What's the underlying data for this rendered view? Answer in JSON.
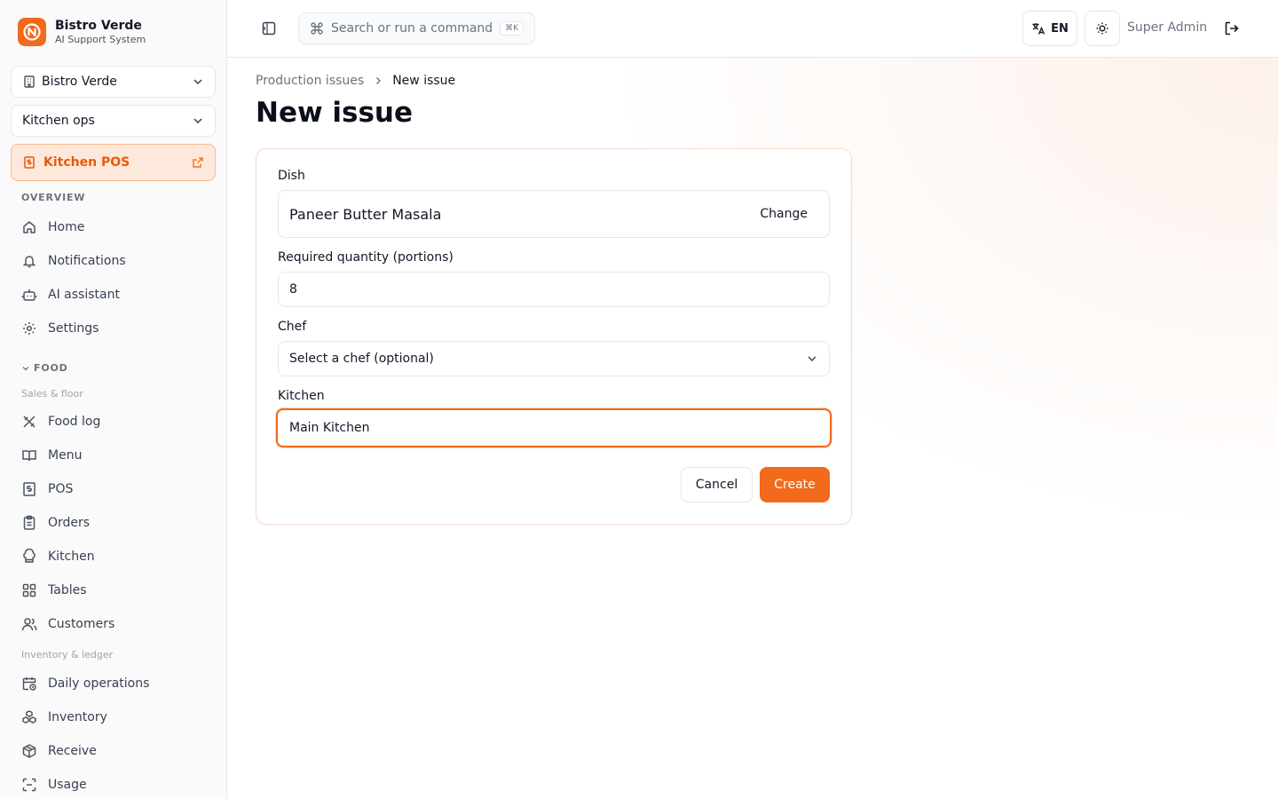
{
  "brand": {
    "title": "Bistro Verde",
    "subtitle": "AI Support System",
    "logo_color": "#f26a1b"
  },
  "sidebar": {
    "restaurant_select": "Bistro Verde",
    "workspace_select": "Kitchen ops",
    "pos_link": "Kitchen POS",
    "overview_label": "OVERVIEW",
    "overview_items": [
      {
        "label": "Home",
        "icon": "home-icon"
      },
      {
        "label": "Notifications",
        "icon": "bell-icon"
      },
      {
        "label": "AI assistant",
        "icon": "bot-icon"
      },
      {
        "label": "Settings",
        "icon": "gear-icon"
      }
    ],
    "food_label": "FOOD",
    "sales_group": "Sales & floor",
    "sales_items": [
      {
        "label": "Food log",
        "icon": "utensils-icon"
      },
      {
        "label": "Menu",
        "icon": "book-icon"
      },
      {
        "label": "POS",
        "icon": "receipt-icon"
      },
      {
        "label": "Orders",
        "icon": "clipboard-icon"
      },
      {
        "label": "Kitchen",
        "icon": "chef-hat-icon"
      },
      {
        "label": "Tables",
        "icon": "grid-icon"
      },
      {
        "label": "Customers",
        "icon": "users-icon"
      }
    ],
    "inventory_group": "Inventory & ledger",
    "inventory_items": [
      {
        "label": "Daily operations",
        "icon": "calendar-clock-icon"
      },
      {
        "label": "Inventory",
        "icon": "boxes-icon"
      },
      {
        "label": "Receive",
        "icon": "package-icon"
      },
      {
        "label": "Usage",
        "icon": "scan-icon"
      }
    ]
  },
  "topbar": {
    "search_placeholder": "Search or run a command",
    "shortcut": "⌘K",
    "language": "EN",
    "user": "Super Admin"
  },
  "main": {
    "breadcrumb": {
      "parent": "Production issues",
      "current": "New issue"
    },
    "title": "New issue",
    "form": {
      "dish_label": "Dish",
      "dish_value": "Paneer Butter Masala",
      "change_label": "Change",
      "quantity_label": "Required quantity (portions)",
      "quantity_value": "8",
      "chef_label": "Chef",
      "chef_placeholder": "Select a chef (optional)",
      "kitchen_label": "Kitchen",
      "kitchen_value": "Main Kitchen",
      "cancel_label": "Cancel",
      "create_label": "Create"
    }
  },
  "colors": {
    "accent": "#f26a1b",
    "accent_soft": "#fde9dc"
  }
}
